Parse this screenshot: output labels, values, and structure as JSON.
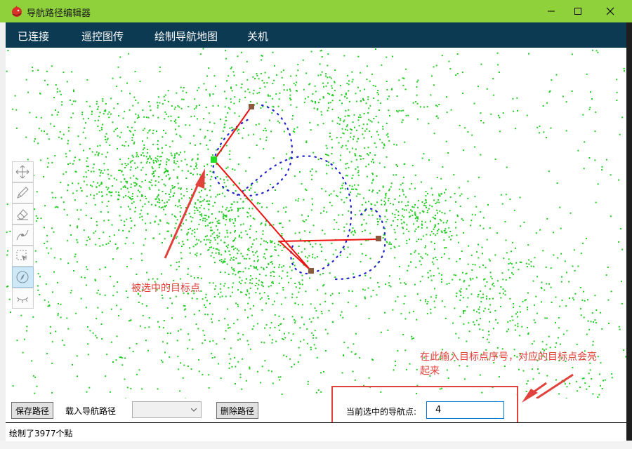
{
  "window": {
    "title": "导航路径编辑器"
  },
  "menu": {
    "items": [
      {
        "id": "connect",
        "label": "已连接"
      },
      {
        "id": "remote",
        "label": "遥控图传"
      },
      {
        "id": "draw_map",
        "label": "绘制导航地图"
      },
      {
        "id": "shutdown",
        "label": "关机"
      }
    ]
  },
  "tools": [
    {
      "name": "move-tool",
      "icon": "move-icon"
    },
    {
      "name": "pencil-tool",
      "icon": "pencil-icon"
    },
    {
      "name": "eraser-tool",
      "icon": "eraser-icon"
    },
    {
      "name": "path-tool",
      "icon": "path-icon"
    },
    {
      "name": "select-tool",
      "icon": "select-icon"
    },
    {
      "name": "compass-tool",
      "icon": "compass-icon",
      "active": true
    },
    {
      "name": "eye-tool",
      "icon": "eye-closed-icon"
    }
  ],
  "annotations": {
    "selected_point": "被选中的目标点",
    "input_hint_line1": "在此输入目标点序号，对应的目标点会亮",
    "input_hint_line2": "起来"
  },
  "bottom": {
    "save_label": "保存路径",
    "load_label": "载入导航路径",
    "load_value": "",
    "delete_label": "删除路径",
    "current_label": "当前选中的导航点:",
    "current_value": "4"
  },
  "status": {
    "text": "绘制了3977个點"
  },
  "colors": {
    "title_bar": "#8ed13a",
    "menu_bar": "#0c3a52",
    "point_cloud": "#22cc22",
    "path": "#ee1111",
    "waypoint": "#8b5a3c",
    "selected_waypoint": "#22dd22",
    "trajectory": "#2222cc",
    "annotation": "#e0413a"
  }
}
